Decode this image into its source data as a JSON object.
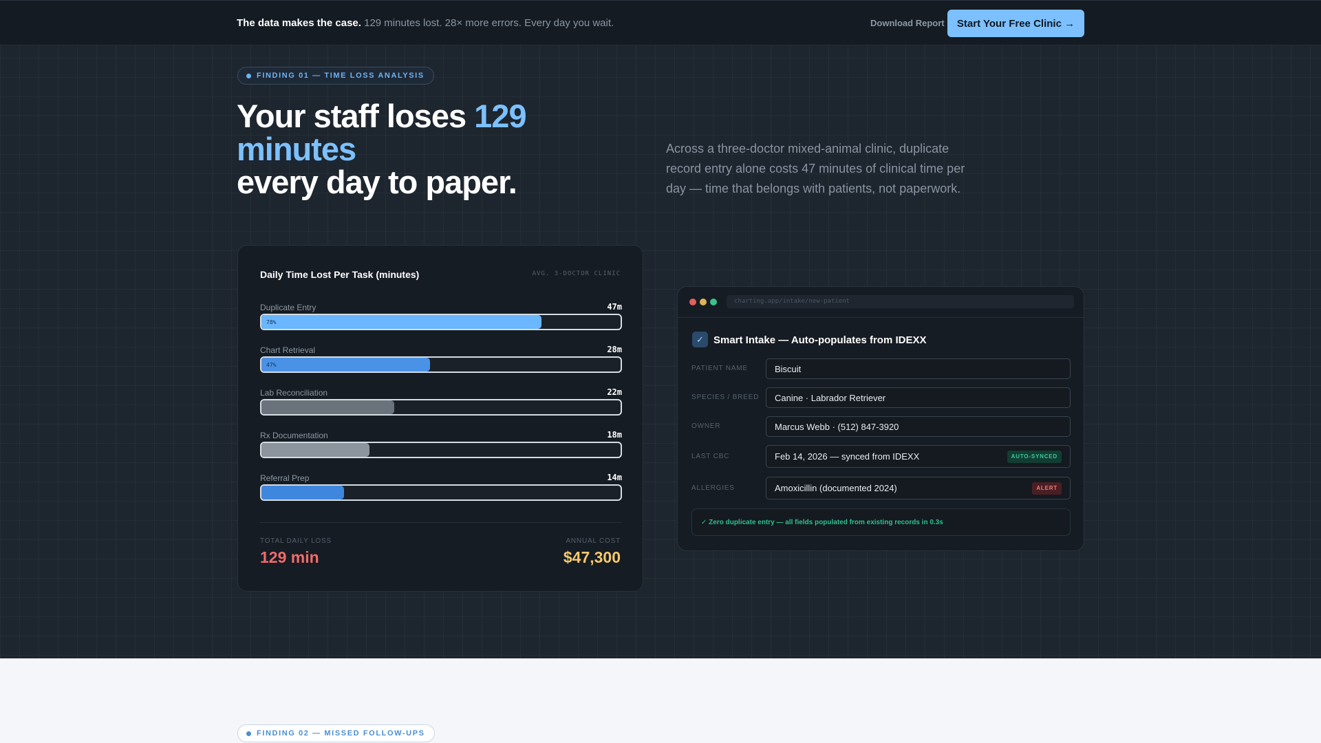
{
  "topbar": {
    "lead": "The data makes the case.",
    "message": "129 minutes lost. 28× more errors. Every day you wait.",
    "download_label": "Download Report",
    "cta_label": "Start Your Free Clinic →"
  },
  "finding1": {
    "tag": "FINDING 01 — TIME LOSS ANALYSIS",
    "headline_a": "Your staff loses ",
    "headline_hl": "129 minutes",
    "headline_b": "every day to paper.",
    "subtext": "Across a three-doctor mixed-animal clinic, duplicate record entry alone costs 47 minutes of clinical time per day — time that belongs with patients, not paperwork."
  },
  "chart_data": {
    "type": "bar",
    "title": "Daily Time Lost Per Task (minutes)",
    "meta": "AVG. 3-DOCTOR CLINIC",
    "categories": [
      "Duplicate Entry",
      "Chart Retrieval",
      "Lab Reconciliation",
      "Rx Documentation",
      "Referral Prep"
    ],
    "values": [
      47,
      28,
      22,
      18,
      14
    ],
    "value_labels": [
      "47m",
      "28m",
      "22m",
      "18m",
      "14m"
    ],
    "fill_fractions": [
      0.78,
      0.47,
      0.37,
      0.3,
      0.23
    ],
    "percent_labels": [
      "78%",
      "47%",
      "",
      "",
      ""
    ],
    "colors": [
      "#6ab6ff",
      "#4a92e6",
      "#6a727b",
      "#8c959e",
      "#3f86dd"
    ],
    "xlim": [
      0,
      60
    ]
  },
  "summary": {
    "total_label": "TOTAL DAILY LOSS",
    "total_value": "129 min",
    "total_color": "#f26b6b",
    "annual_label": "ANNUAL COST",
    "annual_value": "$47,300",
    "annual_color": "#f4c96a"
  },
  "intake": {
    "url": "charting.app/intake/new-patient",
    "title": "Smart Intake — Auto-populates from IDEXX",
    "check_icon": "✓",
    "fields": [
      {
        "label": "PATIENT NAME",
        "value": "Biscuit"
      },
      {
        "label": "SPECIES / BREED",
        "value": "Canine · Labrador Retriever"
      },
      {
        "label": "OWNER",
        "value": "Marcus Webb · (512) 847-3920"
      },
      {
        "label": "LAST CBC",
        "value": "Feb 14, 2026 — synced from IDEXX",
        "badge": "AUTO-SYNCED"
      },
      {
        "label": "ALLERGIES",
        "value": "Amoxicillin (documented 2024)",
        "badge": "ALERT"
      }
    ],
    "note": "✓ Zero duplicate entry — all fields populated from existing records in 0.3s"
  },
  "finding2": {
    "tag": "FINDING 02 — MISSED FOLLOW-UPS"
  }
}
